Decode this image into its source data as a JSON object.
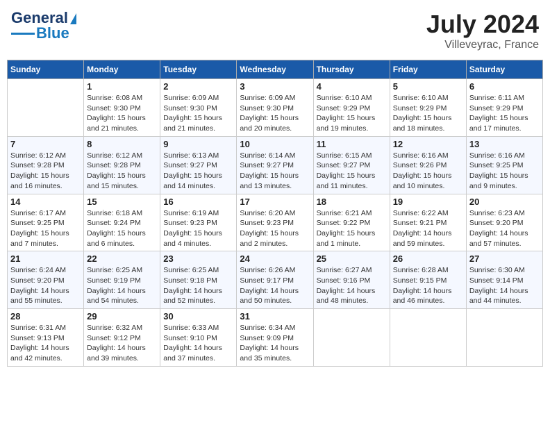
{
  "header": {
    "logo_line1": "General",
    "logo_line2": "Blue",
    "title": "July 2024",
    "subtitle": "Villeveyrac, France"
  },
  "calendar": {
    "days_of_week": [
      "Sunday",
      "Monday",
      "Tuesday",
      "Wednesday",
      "Thursday",
      "Friday",
      "Saturday"
    ],
    "weeks": [
      [
        {
          "day": "",
          "sunrise": "",
          "sunset": "",
          "daylight": ""
        },
        {
          "day": "1",
          "sunrise": "Sunrise: 6:08 AM",
          "sunset": "Sunset: 9:30 PM",
          "daylight": "Daylight: 15 hours and 21 minutes."
        },
        {
          "day": "2",
          "sunrise": "Sunrise: 6:09 AM",
          "sunset": "Sunset: 9:30 PM",
          "daylight": "Daylight: 15 hours and 21 minutes."
        },
        {
          "day": "3",
          "sunrise": "Sunrise: 6:09 AM",
          "sunset": "Sunset: 9:30 PM",
          "daylight": "Daylight: 15 hours and 20 minutes."
        },
        {
          "day": "4",
          "sunrise": "Sunrise: 6:10 AM",
          "sunset": "Sunset: 9:29 PM",
          "daylight": "Daylight: 15 hours and 19 minutes."
        },
        {
          "day": "5",
          "sunrise": "Sunrise: 6:10 AM",
          "sunset": "Sunset: 9:29 PM",
          "daylight": "Daylight: 15 hours and 18 minutes."
        },
        {
          "day": "6",
          "sunrise": "Sunrise: 6:11 AM",
          "sunset": "Sunset: 9:29 PM",
          "daylight": "Daylight: 15 hours and 17 minutes."
        }
      ],
      [
        {
          "day": "7",
          "sunrise": "Sunrise: 6:12 AM",
          "sunset": "Sunset: 9:28 PM",
          "daylight": "Daylight: 15 hours and 16 minutes."
        },
        {
          "day": "8",
          "sunrise": "Sunrise: 6:12 AM",
          "sunset": "Sunset: 9:28 PM",
          "daylight": "Daylight: 15 hours and 15 minutes."
        },
        {
          "day": "9",
          "sunrise": "Sunrise: 6:13 AM",
          "sunset": "Sunset: 9:27 PM",
          "daylight": "Daylight: 15 hours and 14 minutes."
        },
        {
          "day": "10",
          "sunrise": "Sunrise: 6:14 AM",
          "sunset": "Sunset: 9:27 PM",
          "daylight": "Daylight: 15 hours and 13 minutes."
        },
        {
          "day": "11",
          "sunrise": "Sunrise: 6:15 AM",
          "sunset": "Sunset: 9:27 PM",
          "daylight": "Daylight: 15 hours and 11 minutes."
        },
        {
          "day": "12",
          "sunrise": "Sunrise: 6:16 AM",
          "sunset": "Sunset: 9:26 PM",
          "daylight": "Daylight: 15 hours and 10 minutes."
        },
        {
          "day": "13",
          "sunrise": "Sunrise: 6:16 AM",
          "sunset": "Sunset: 9:25 PM",
          "daylight": "Daylight: 15 hours and 9 minutes."
        }
      ],
      [
        {
          "day": "14",
          "sunrise": "Sunrise: 6:17 AM",
          "sunset": "Sunset: 9:25 PM",
          "daylight": "Daylight: 15 hours and 7 minutes."
        },
        {
          "day": "15",
          "sunrise": "Sunrise: 6:18 AM",
          "sunset": "Sunset: 9:24 PM",
          "daylight": "Daylight: 15 hours and 6 minutes."
        },
        {
          "day": "16",
          "sunrise": "Sunrise: 6:19 AM",
          "sunset": "Sunset: 9:23 PM",
          "daylight": "Daylight: 15 hours and 4 minutes."
        },
        {
          "day": "17",
          "sunrise": "Sunrise: 6:20 AM",
          "sunset": "Sunset: 9:23 PM",
          "daylight": "Daylight: 15 hours and 2 minutes."
        },
        {
          "day": "18",
          "sunrise": "Sunrise: 6:21 AM",
          "sunset": "Sunset: 9:22 PM",
          "daylight": "Daylight: 15 hours and 1 minute."
        },
        {
          "day": "19",
          "sunrise": "Sunrise: 6:22 AM",
          "sunset": "Sunset: 9:21 PM",
          "daylight": "Daylight: 14 hours and 59 minutes."
        },
        {
          "day": "20",
          "sunrise": "Sunrise: 6:23 AM",
          "sunset": "Sunset: 9:20 PM",
          "daylight": "Daylight: 14 hours and 57 minutes."
        }
      ],
      [
        {
          "day": "21",
          "sunrise": "Sunrise: 6:24 AM",
          "sunset": "Sunset: 9:20 PM",
          "daylight": "Daylight: 14 hours and 55 minutes."
        },
        {
          "day": "22",
          "sunrise": "Sunrise: 6:25 AM",
          "sunset": "Sunset: 9:19 PM",
          "daylight": "Daylight: 14 hours and 54 minutes."
        },
        {
          "day": "23",
          "sunrise": "Sunrise: 6:25 AM",
          "sunset": "Sunset: 9:18 PM",
          "daylight": "Daylight: 14 hours and 52 minutes."
        },
        {
          "day": "24",
          "sunrise": "Sunrise: 6:26 AM",
          "sunset": "Sunset: 9:17 PM",
          "daylight": "Daylight: 14 hours and 50 minutes."
        },
        {
          "day": "25",
          "sunrise": "Sunrise: 6:27 AM",
          "sunset": "Sunset: 9:16 PM",
          "daylight": "Daylight: 14 hours and 48 minutes."
        },
        {
          "day": "26",
          "sunrise": "Sunrise: 6:28 AM",
          "sunset": "Sunset: 9:15 PM",
          "daylight": "Daylight: 14 hours and 46 minutes."
        },
        {
          "day": "27",
          "sunrise": "Sunrise: 6:30 AM",
          "sunset": "Sunset: 9:14 PM",
          "daylight": "Daylight: 14 hours and 44 minutes."
        }
      ],
      [
        {
          "day": "28",
          "sunrise": "Sunrise: 6:31 AM",
          "sunset": "Sunset: 9:13 PM",
          "daylight": "Daylight: 14 hours and 42 minutes."
        },
        {
          "day": "29",
          "sunrise": "Sunrise: 6:32 AM",
          "sunset": "Sunset: 9:12 PM",
          "daylight": "Daylight: 14 hours and 39 minutes."
        },
        {
          "day": "30",
          "sunrise": "Sunrise: 6:33 AM",
          "sunset": "Sunset: 9:10 PM",
          "daylight": "Daylight: 14 hours and 37 minutes."
        },
        {
          "day": "31",
          "sunrise": "Sunrise: 6:34 AM",
          "sunset": "Sunset: 9:09 PM",
          "daylight": "Daylight: 14 hours and 35 minutes."
        },
        {
          "day": "",
          "sunrise": "",
          "sunset": "",
          "daylight": ""
        },
        {
          "day": "",
          "sunrise": "",
          "sunset": "",
          "daylight": ""
        },
        {
          "day": "",
          "sunrise": "",
          "sunset": "",
          "daylight": ""
        }
      ]
    ]
  }
}
